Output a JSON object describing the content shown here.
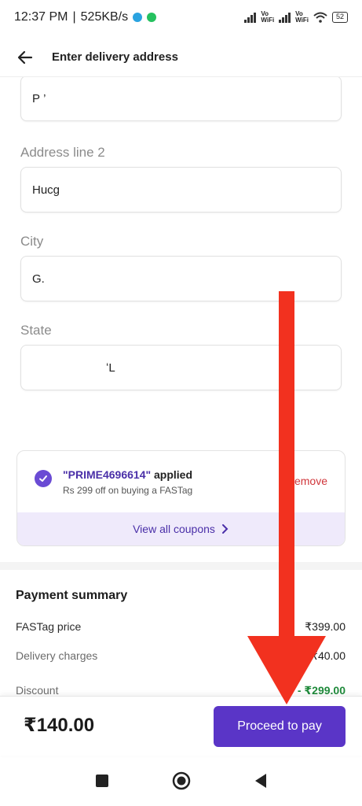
{
  "status_bar": {
    "time": "12:37 PM",
    "network_speed": "525KB/s",
    "vo_top": "Vo",
    "vo_bottom": "WiFi",
    "battery": "52",
    "icons": [
      "telegram-icon",
      "whatsapp-icon",
      "signal-icon",
      "wifi-icon",
      "battery-icon"
    ]
  },
  "header": {
    "title": "Enter delivery address",
    "back_icon": "arrow-left-icon"
  },
  "form": {
    "address_line_1_value": "Р ’",
    "address_line_2_label": "Address line 2",
    "address_line_2_value": "Huсɡ",
    "city_label": "City",
    "city_value": "G.",
    "state_label": "State",
    "state_value": "ʻL"
  },
  "coupon": {
    "code": "\"PRIME4696614\"",
    "applied": " applied",
    "description": "Rs 299 off on buying a FASTag",
    "remove_label": "Remove",
    "view_all_label": "View all coupons"
  },
  "payment_summary": {
    "title": "Payment summary",
    "rows": [
      {
        "label": "FASTag price",
        "value": "₹399.00"
      },
      {
        "label": "Delivery charges",
        "value": "₹40.00"
      },
      {
        "label": "Discount",
        "value": "- ₹299.00"
      }
    ]
  },
  "footer": {
    "total": "₹140.00",
    "pay_button": "Proceed to pay"
  },
  "colors": {
    "accent": "#5a35c7",
    "coupon_bg": "#efeafb",
    "remove": "#d0363b",
    "discount": "#1f8a3b",
    "annotation_arrow": "#f2311f"
  }
}
